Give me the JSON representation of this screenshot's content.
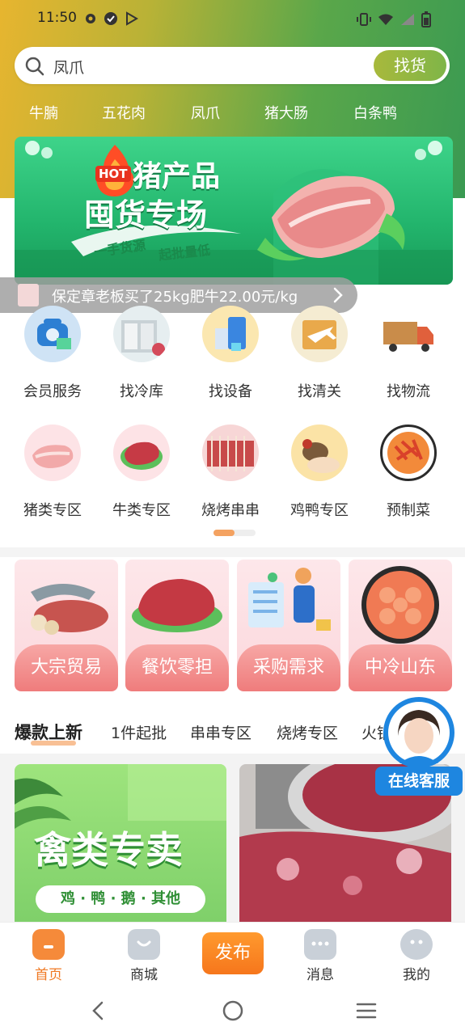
{
  "status_bar": {
    "time": "11:50"
  },
  "search": {
    "value": "凤爪",
    "button": "找货"
  },
  "quick_tags": [
    "牛腩",
    "五花肉",
    "凤爪",
    "猪大肠",
    "白条鸭"
  ],
  "banner": {
    "badge": "HOT",
    "title_line1": "猪产品",
    "title_line2": "囤货专场",
    "tagline_a": "一手货源",
    "tagline_b": "起批量低"
  },
  "ticker": {
    "text": "保定章老板买了25kg肥牛22.00元/kg"
  },
  "services": [
    {
      "label": "会员服务",
      "icon": "phone-icon"
    },
    {
      "label": "找冷库",
      "icon": "cold-storage-icon"
    },
    {
      "label": "找设备",
      "icon": "equipment-icon"
    },
    {
      "label": "找清关",
      "icon": "customs-icon"
    },
    {
      "label": "找物流",
      "icon": "truck-icon"
    }
  ],
  "categories": [
    {
      "label": "猪类专区",
      "icon": "pork-icon"
    },
    {
      "label": "牛类专区",
      "icon": "beef-icon"
    },
    {
      "label": "烧烤串串",
      "icon": "skewer-icon"
    },
    {
      "label": "鸡鸭专区",
      "icon": "poultry-icon"
    },
    {
      "label": "预制菜",
      "icon": "prepared-dish-icon"
    }
  ],
  "feature_cards": [
    {
      "label": "大宗贸易"
    },
    {
      "label": "餐饮零担"
    },
    {
      "label": "采购需求"
    },
    {
      "label": "中冷山东"
    }
  ],
  "feed_tabs": [
    "爆款上新",
    "1件起批",
    "串串专区",
    "烧烤专区",
    "火锅"
  ],
  "products": [
    {
      "title": "禽类专卖",
      "subtitle": "鸡 · 鸭 · 鹅 · 其他"
    }
  ],
  "online_service": {
    "label": "在线客服"
  },
  "bottom_nav": {
    "home": "首页",
    "mall": "商城",
    "publish": "发布",
    "messages": "消息",
    "mine": "我的"
  },
  "colors": {
    "accent": "#f07a24",
    "brand_green": "#2fb56c",
    "card_pink": "#ef7c7c"
  }
}
